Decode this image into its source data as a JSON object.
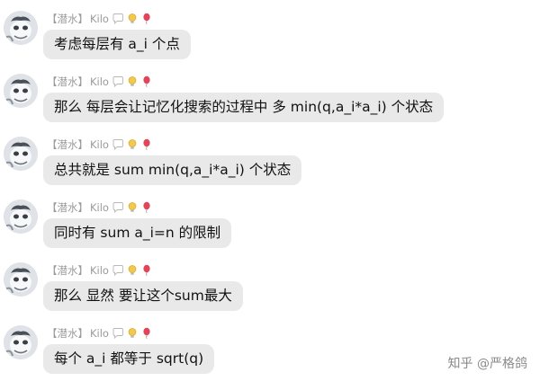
{
  "messages": [
    {
      "title": "【潜水】",
      "nick": "Kilo",
      "text": "考虑每层有 a_i 个点"
    },
    {
      "title": "【潜水】",
      "nick": "Kilo",
      "text": "那么 每层会让记忆化搜索的过程中 多 min(q,a_i*a_i) 个状态"
    },
    {
      "title": "【潜水】",
      "nick": "Kilo",
      "text": "总共就是 sum min(q,a_i*a_i) 个状态"
    },
    {
      "title": "【潜水】",
      "nick": "Kilo",
      "text": "同时有 sum a_i=n 的限制"
    },
    {
      "title": "【潜水】",
      "nick": "Kilo",
      "text": "那么 显然 要让这个sum最大"
    },
    {
      "title": "【潜水】",
      "nick": "Kilo",
      "text": "每个 a_i 都等于 sqrt(q)"
    }
  ],
  "badges": [
    "speech-bubble-icon",
    "lightbulb-icon",
    "balloon-icon"
  ],
  "watermark": "知乎 @严格鸽",
  "colors": {
    "bubble": "#e9e9e9",
    "meta_text": "#9a9a9a",
    "balloon": "#e0455a",
    "bulb": "#f2c94c"
  }
}
